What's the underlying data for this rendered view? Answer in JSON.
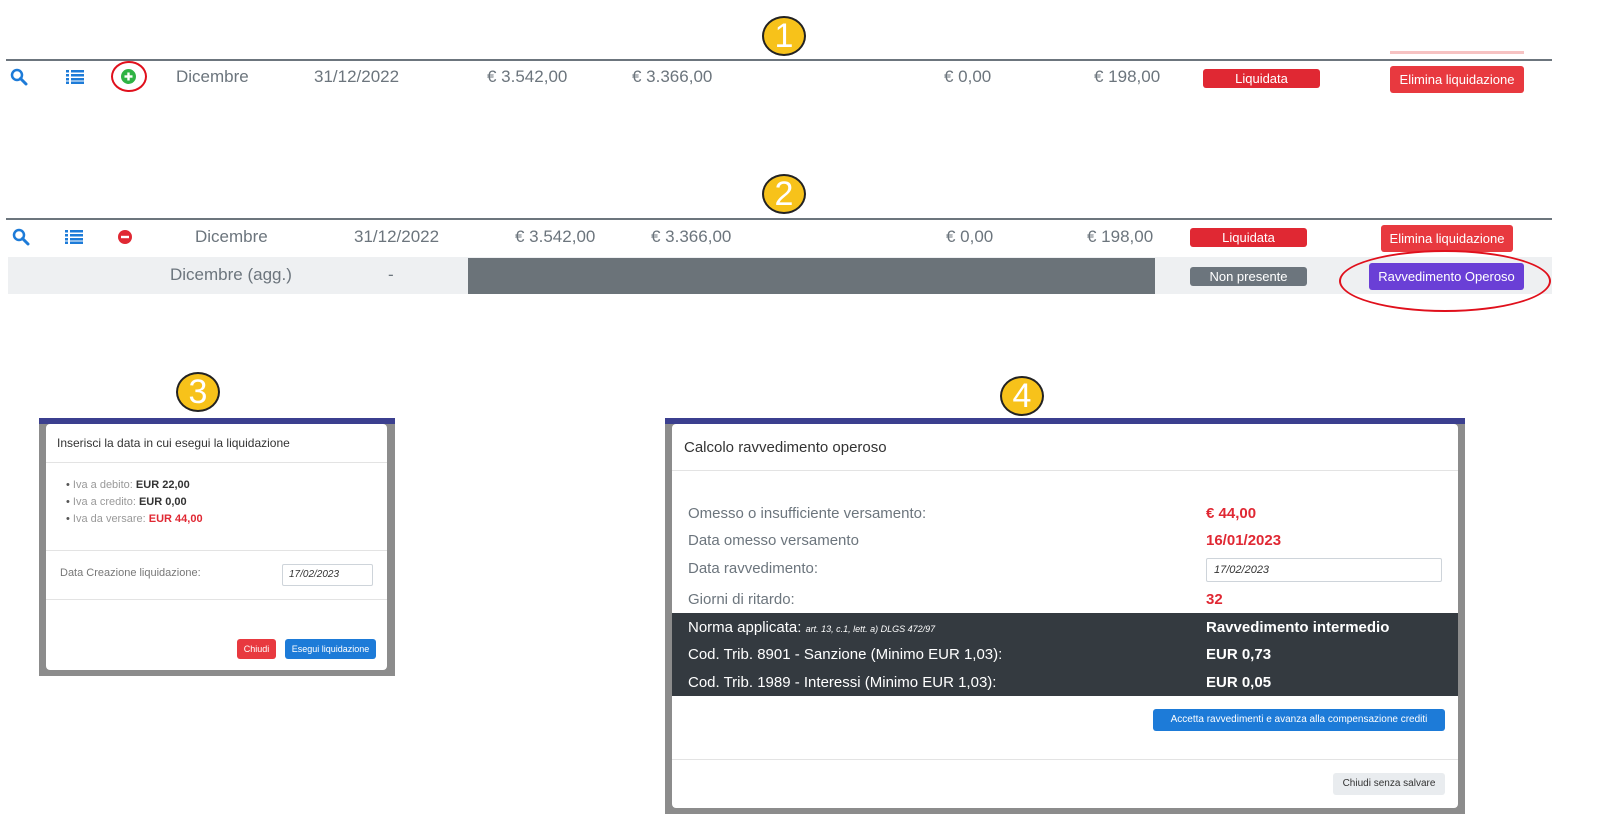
{
  "markers": [
    "1",
    "2",
    "3",
    "4"
  ],
  "row1": {
    "month": "Dicembre",
    "date": "31/12/2022",
    "amount1": "€ 3.542,00",
    "amount2": "€ 3.366,00",
    "amount3": "€ 0,00",
    "amount4": "€ 198,00",
    "status": "Liquidata",
    "action": "Elimina liquidazione"
  },
  "row2": {
    "month": "Dicembre",
    "date": "31/12/2022",
    "amount1": "€ 3.542,00",
    "amount2": "€ 3.366,00",
    "amount3": "€ 0,00",
    "amount4": "€ 198,00",
    "status": "Liquidata",
    "action": "Elimina liquidazione"
  },
  "row2_sub": {
    "month": "Dicembre (agg.)",
    "date": "-",
    "status": "Non presente",
    "action": "Ravvedimento Operoso"
  },
  "modal3": {
    "title": "Inserisci la data in cui esegui la liquidazione",
    "items": [
      {
        "label": "Iva a debito:",
        "value": "EUR 22,00"
      },
      {
        "label": "Iva a credito:",
        "value": "EUR 0,00"
      },
      {
        "label": "Iva da versare:",
        "value": "EUR 44,00"
      }
    ],
    "date_label": "Data Creazione liquidazione:",
    "date_value": "17/02/2023",
    "close_label": "Chiudi",
    "run_label": "Esegui liquidazione"
  },
  "modal4": {
    "title": "Calcolo ravvedimento operoso",
    "rows": [
      {
        "label": "Omesso o insufficiente versamento:",
        "value": "€ 44,00"
      },
      {
        "label": "Data omesso versamento",
        "value": "16/01/2023"
      },
      {
        "label": "Data ravvedimento:",
        "value": "17/02/2023"
      },
      {
        "label": "Giorni di ritardo:",
        "value": "32"
      }
    ],
    "dark_rows": [
      {
        "label": "Norma applicata:",
        "note": "art. 13, c.1, lett. a) DLGS 472/97",
        "value": "Ravvedimento intermedio"
      },
      {
        "label": "Cod. Trib. 8901 - Sanzione (Minimo EUR 1,03):",
        "value": "EUR 0,73"
      },
      {
        "label": "Cod. Trib. 1989 - Interessi (Minimo EUR 1,03):",
        "value": "EUR 0,05"
      }
    ],
    "accept_label": "Accetta ravvedimenti e avanza alla compensazione crediti",
    "close_label": "Chiudi senza salvare"
  },
  "colors": {
    "primary": "#1d7bd8",
    "danger": "#e8393f",
    "liquidata": "#e02833",
    "purple": "#6a3fd6",
    "grey_badge": "#6c757d",
    "marker": "#f7c21a"
  }
}
